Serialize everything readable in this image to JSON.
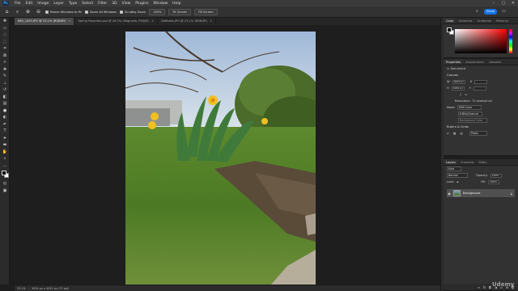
{
  "app": {
    "menu": [
      "File",
      "Edit",
      "Image",
      "Layer",
      "Type",
      "Select",
      "Filter",
      "3D",
      "View",
      "Plugins",
      "Window",
      "Help"
    ],
    "logo": "Ps"
  },
  "options_bar": {
    "resize_windows": "Resize Windows to Fit",
    "zoom_all_windows": "Zoom All Windows",
    "scrubby_zoom": "Scrubby Zoom",
    "zoom_100": "100%",
    "fit_screen": "Fit Screen",
    "fill_screen": "Fill Screen",
    "share": "Share"
  },
  "tabs": [
    {
      "label": "IMG_1497.JPG @ 23.1% (RGB/8*)",
      "active": true
    },
    {
      "label": "Spring Favorites.psd @ 16.2% (Magnolia, RGB/8)",
      "active": false
    },
    {
      "label": "Daffodils.JPG @ 23.1% (RGB/8*)",
      "active": false
    }
  ],
  "status_bar": {
    "zoom": "23.1%",
    "dimensions": "3024 px x 4032 px (72 ppi)"
  },
  "color_panel": {
    "tabs": [
      "Color",
      "Swatches",
      "Gradients",
      "Patterns"
    ],
    "foreground": "#000000",
    "background": "#ffffff"
  },
  "properties_panel": {
    "tabs": [
      "Properties",
      "Adjustments",
      "Libraries"
    ],
    "doc_label": "Document",
    "canvas_title": "Canvas",
    "width_label": "W",
    "width_value": "3024 px",
    "height_label": "H",
    "height_value": "4032 px",
    "x_label": "X",
    "y_label": "Y",
    "resolution": "Resolution: 72 pixels/inch",
    "mode_label": "Mode",
    "mode_value": "RGB Color",
    "depth_value": "8 Bits/Channel",
    "fill_value": "Background Color",
    "rulers_title": "Rulers & Grids",
    "units_value": "Pixels"
  },
  "layers_panel": {
    "tabs": [
      "Layers",
      "Channels",
      "Paths"
    ],
    "kind": "Kind",
    "blend_mode": "Normal",
    "opacity_label": "Opacity:",
    "opacity": "100%",
    "lock_label": "Lock:",
    "fill_label": "Fill:",
    "fill": "100%",
    "layers": [
      {
        "name": "Background",
        "visible": true,
        "locked": true
      }
    ]
  },
  "watermark": "Udemy"
}
